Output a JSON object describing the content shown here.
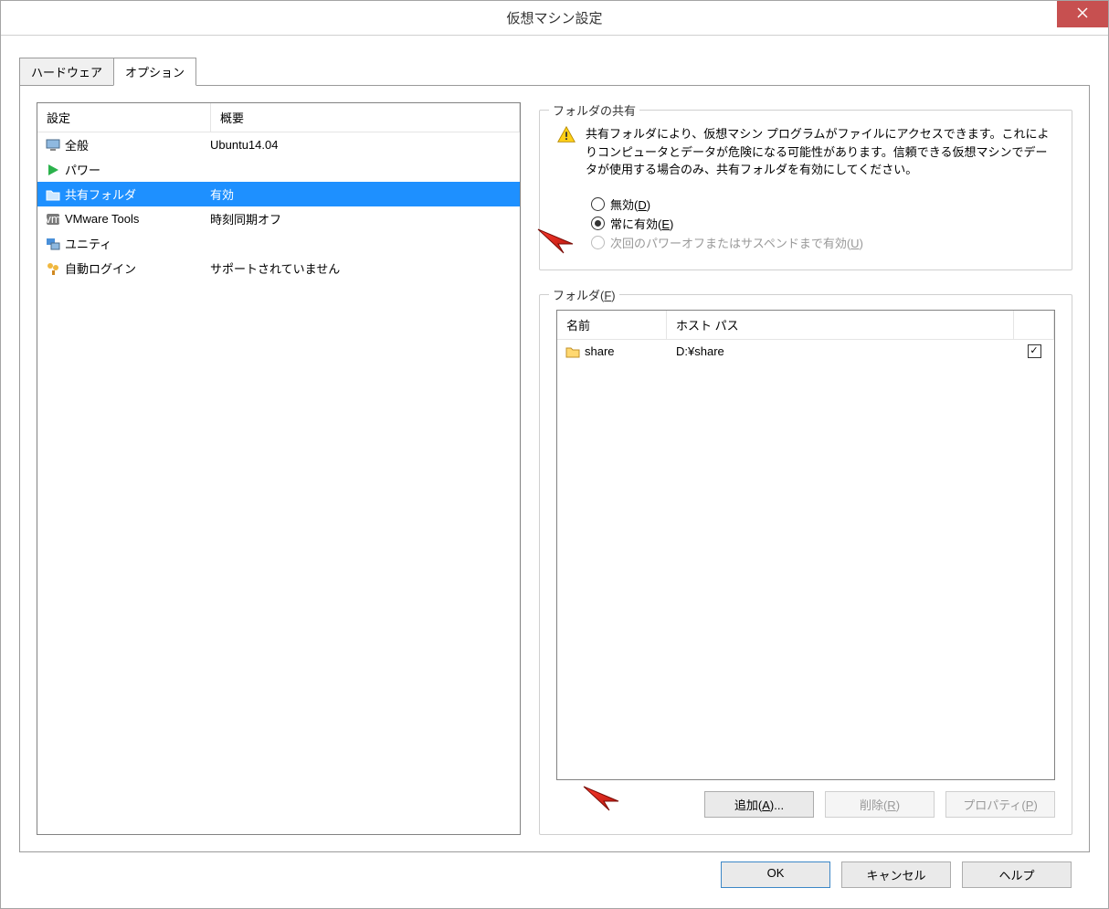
{
  "title": "仮想マシン設定",
  "tabs": {
    "hardware": "ハードウェア",
    "options": "オプション"
  },
  "settings_columns": {
    "name": "設定",
    "summary": "概要"
  },
  "settings_rows": [
    {
      "icon": "monitor-icon",
      "name": "全般",
      "summary": "Ubuntu14.04",
      "selected": false
    },
    {
      "icon": "play-icon",
      "name": "パワー",
      "summary": "",
      "selected": false
    },
    {
      "icon": "folder-share-icon",
      "name": "共有フォルダ",
      "summary": "有効",
      "selected": true
    },
    {
      "icon": "vm-icon",
      "name": "VMware Tools",
      "summary": "時刻同期オフ",
      "selected": false
    },
    {
      "icon": "unity-icon",
      "name": "ユニティ",
      "summary": "",
      "selected": false
    },
    {
      "icon": "users-icon",
      "name": "自動ログイン",
      "summary": "サポートされていません",
      "selected": false
    }
  ],
  "folder_sharing": {
    "group_title": "フォルダの共有",
    "warning_text": "共有フォルダにより、仮想マシン プログラムがファイルにアクセスできます。これによりコンピュータとデータが危険になる可能性があります。信頼できる仮想マシンでデータが使用する場合のみ、共有フォルダを有効にしてください。",
    "radios": {
      "disabled_label": "無効(",
      "disabled_key": "D",
      "always_label": "常に有効(",
      "always_key": "E",
      "until_label": "次回のパワーオフまたはサスペンドまで有効(",
      "until_key": "U",
      "close_paren": ")"
    },
    "selected": "always"
  },
  "folders": {
    "group_title": "フォルダ(",
    "group_title_key": "F",
    "group_title_close": ")",
    "columns": {
      "name": "名前",
      "path": "ホスト パス",
      "check": ""
    },
    "rows": [
      {
        "name": "share",
        "path": "D:¥share",
        "checked": true
      }
    ],
    "buttons": {
      "add": "追加(",
      "add_key": "A",
      "add_suffix": ")...",
      "remove": "削除(",
      "remove_key": "R",
      "remove_close": ")",
      "props": "プロパティ(",
      "props_key": "P",
      "props_close": ")"
    }
  },
  "bottom": {
    "ok": "OK",
    "cancel": "キャンセル",
    "help": "ヘルプ"
  }
}
